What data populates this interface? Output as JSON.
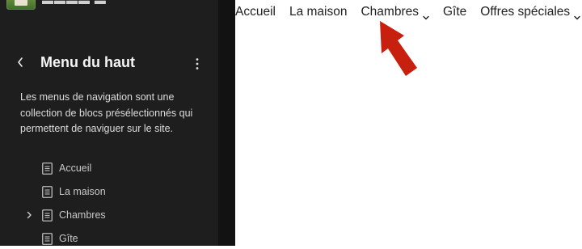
{
  "sidebar": {
    "title": "Menu du haut",
    "description": "Les menus de navigation sont une collection de blocs présélectionnés qui permettent de naviguer sur le site.",
    "back_icon": "chevron-left-icon",
    "more_icon": "more-vertical-icon",
    "items": [
      {
        "label": "Accueil",
        "icon": "page-icon",
        "expandable": false
      },
      {
        "label": "La maison",
        "icon": "page-icon",
        "expandable": false
      },
      {
        "label": "Chambres",
        "icon": "page-icon",
        "expandable": true
      },
      {
        "label": "Gîte",
        "icon": "page-icon",
        "expandable": false
      }
    ]
  },
  "preview_nav": {
    "items": [
      {
        "label": "Accueil",
        "has_submenu": false
      },
      {
        "label": "La maison",
        "has_submenu": false
      },
      {
        "label": "Chambres",
        "has_submenu": true
      },
      {
        "label": "Gîte",
        "has_submenu": false
      },
      {
        "label": "Offres spéciales",
        "has_submenu": true
      }
    ]
  },
  "annotation": {
    "arrow_color": "#c8200e",
    "points_to": "Chambres"
  },
  "colors": {
    "sidebar_bg": "#1e1e1e",
    "preview_bg": "#ffffff"
  }
}
